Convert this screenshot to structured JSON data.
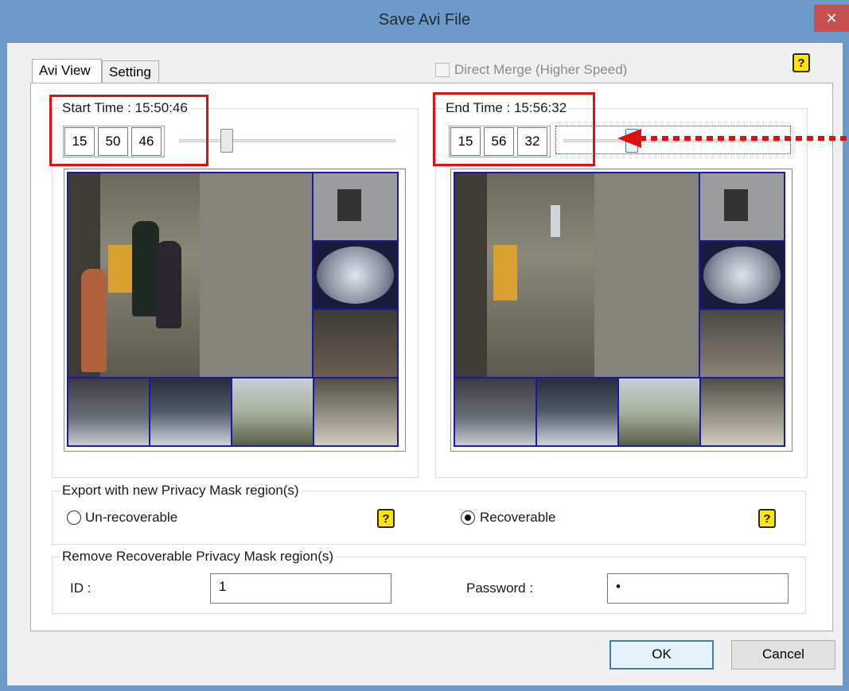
{
  "window": {
    "title": "Save Avi File",
    "close_glyph": "✕"
  },
  "tabs": [
    {
      "label": "Avi View",
      "active": true
    },
    {
      "label": "Setting",
      "active": false
    }
  ],
  "direct_merge": {
    "label": "Direct Merge (Higher Speed)",
    "checked": false,
    "enabled": false
  },
  "help_glyph": "?",
  "start": {
    "label": "Start Time : 15:50:46",
    "hour": "15",
    "minute": "50",
    "second": "46",
    "slider_fraction": 0.22
  },
  "end": {
    "label": "End Time : 15:56:32",
    "hour": "15",
    "minute": "56",
    "second": "32",
    "slider_fraction": 0.31
  },
  "privacy_export": {
    "legend": "Export with new Privacy Mask region(s)",
    "options": [
      {
        "label": "Un-recoverable",
        "selected": false
      },
      {
        "label": "Recoverable",
        "selected": true
      }
    ]
  },
  "privacy_remove": {
    "legend": "Remove Recoverable Privacy Mask region(s)",
    "id_label": "ID :",
    "id_value": "1",
    "password_label": "Password :",
    "password_value": "•"
  },
  "buttons": {
    "ok": "OK",
    "cancel": "Cancel"
  },
  "colors": {
    "annotation_red": "#e01010",
    "title_bar": "#6c9ac9",
    "camera_border": "#1a1aa8",
    "help_icon": "#ffe600"
  }
}
